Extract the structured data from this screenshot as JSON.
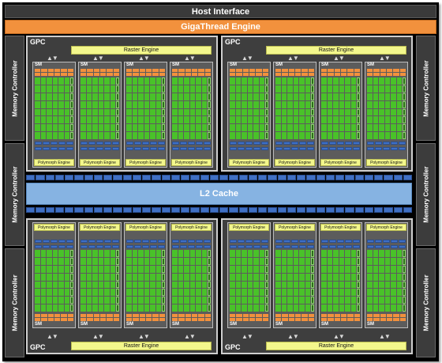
{
  "header": {
    "host_interface": "Host Interface",
    "gigathread_engine": "GigaThread Engine"
  },
  "memory_controller_label": "Memory Controller",
  "l2_cache_label": "L2 Cache",
  "gpc": {
    "label": "GPC",
    "raster_engine": "Raster Engine",
    "sm_label": "SM",
    "polymorph_engine": "Polymorph Engine"
  },
  "colors": {
    "frame": "#000000",
    "gpc_fill": "#3e3e3e",
    "gpc_border": "#cfcfcf",
    "cuda_core": "#49c229",
    "raster_engine": "#f3f78c",
    "gigathread": "#f2913d",
    "l2_cache": "#86b3e2",
    "register_strip": "#3f6fc4"
  }
}
